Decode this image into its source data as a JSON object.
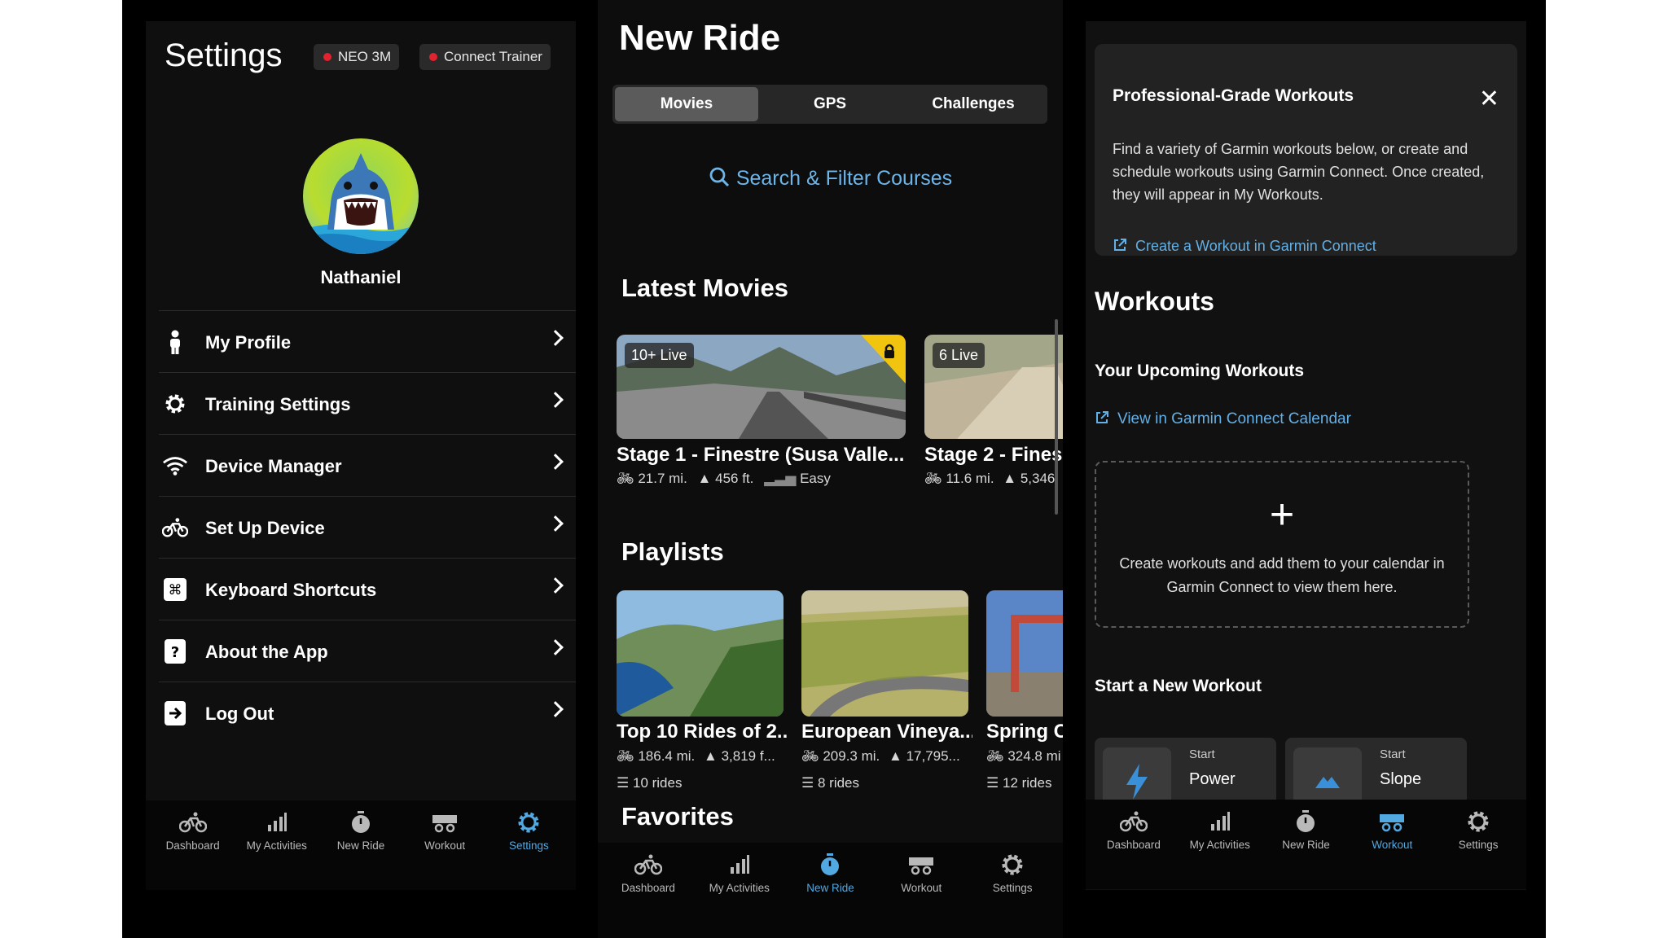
{
  "settings": {
    "title": "Settings",
    "chip_device": "NEO 3M",
    "chip_connect": "Connect Trainer",
    "username": "Nathaniel",
    "menu": [
      {
        "label": "My Profile"
      },
      {
        "label": "Training Settings"
      },
      {
        "label": "Device Manager"
      },
      {
        "label": "Set Up Device"
      },
      {
        "label": "Keyboard Shortcuts"
      },
      {
        "label": "About the App"
      },
      {
        "label": "Log Out"
      }
    ]
  },
  "tabs": [
    "Dashboard",
    "My Activities",
    "New Ride",
    "Workout",
    "Settings"
  ],
  "ride": {
    "title": "New Ride",
    "segments": [
      "Movies",
      "GPS",
      "Challenges"
    ],
    "search": "Search & Filter Courses",
    "latest_title": "Latest Movies",
    "movies": [
      {
        "live": "10+ Live",
        "title": "Stage 1 - Finestre (Susa Valle...",
        "dist": "21.7 mi.",
        "elev": "456 ft.",
        "difficulty": "Easy"
      },
      {
        "live": "6 Live",
        "title": "Stage 2 - Fines",
        "dist": "11.6 mi.",
        "elev": "5,346"
      }
    ],
    "playlists_title": "Playlists",
    "playlists": [
      {
        "title": "Top 10 Rides of 2...",
        "dist": "186.4 mi.",
        "elev": "3,819 f...",
        "rides": "10 rides"
      },
      {
        "title": "European Vineya...",
        "dist": "209.3 mi.",
        "elev": "17,795...",
        "rides": "8 rides"
      },
      {
        "title": "Spring C",
        "dist": "324.8 mi",
        "rides": "12 rides"
      }
    ],
    "favorites_title": "Favorites"
  },
  "workout": {
    "banner_title": "Professional-Grade Workouts",
    "banner_desc": "Find a variety of Garmin workouts below, or create and schedule workouts using Garmin Connect. Once created, they will appear in My Workouts.",
    "banner_link": "Create a Workout in Garmin Connect",
    "title": "Workouts",
    "upcoming": "Your Upcoming Workouts",
    "calendar_link": "View in Garmin Connect Calendar",
    "plus": "+",
    "empty_text": "Create workouts and add them to your calendar in Garmin Connect to view them here.",
    "start_title": "Start a New Workout",
    "cards": [
      {
        "small": "Start",
        "name": "Power"
      },
      {
        "small": "Start",
        "name": "Slope"
      }
    ]
  },
  "colors": {
    "accent": "#52a8e0",
    "status_red": "#e2232f"
  }
}
